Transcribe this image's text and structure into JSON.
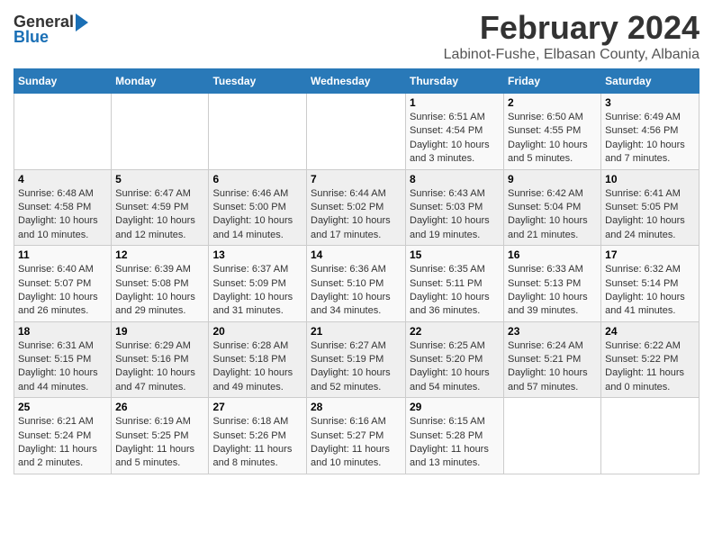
{
  "header": {
    "logo_general": "General",
    "logo_blue": "Blue",
    "month_title": "February 2024",
    "location": "Labinot-Fushe, Elbasan County, Albania"
  },
  "days_of_week": [
    "Sunday",
    "Monday",
    "Tuesday",
    "Wednesday",
    "Thursday",
    "Friday",
    "Saturday"
  ],
  "weeks": [
    [
      {
        "day": "",
        "info": ""
      },
      {
        "day": "",
        "info": ""
      },
      {
        "day": "",
        "info": ""
      },
      {
        "day": "",
        "info": ""
      },
      {
        "day": "1",
        "info": "Sunrise: 6:51 AM\nSunset: 4:54 PM\nDaylight: 10 hours and 3 minutes."
      },
      {
        "day": "2",
        "info": "Sunrise: 6:50 AM\nSunset: 4:55 PM\nDaylight: 10 hours and 5 minutes."
      },
      {
        "day": "3",
        "info": "Sunrise: 6:49 AM\nSunset: 4:56 PM\nDaylight: 10 hours and 7 minutes."
      }
    ],
    [
      {
        "day": "4",
        "info": "Sunrise: 6:48 AM\nSunset: 4:58 PM\nDaylight: 10 hours and 10 minutes."
      },
      {
        "day": "5",
        "info": "Sunrise: 6:47 AM\nSunset: 4:59 PM\nDaylight: 10 hours and 12 minutes."
      },
      {
        "day": "6",
        "info": "Sunrise: 6:46 AM\nSunset: 5:00 PM\nDaylight: 10 hours and 14 minutes."
      },
      {
        "day": "7",
        "info": "Sunrise: 6:44 AM\nSunset: 5:02 PM\nDaylight: 10 hours and 17 minutes."
      },
      {
        "day": "8",
        "info": "Sunrise: 6:43 AM\nSunset: 5:03 PM\nDaylight: 10 hours and 19 minutes."
      },
      {
        "day": "9",
        "info": "Sunrise: 6:42 AM\nSunset: 5:04 PM\nDaylight: 10 hours and 21 minutes."
      },
      {
        "day": "10",
        "info": "Sunrise: 6:41 AM\nSunset: 5:05 PM\nDaylight: 10 hours and 24 minutes."
      }
    ],
    [
      {
        "day": "11",
        "info": "Sunrise: 6:40 AM\nSunset: 5:07 PM\nDaylight: 10 hours and 26 minutes."
      },
      {
        "day": "12",
        "info": "Sunrise: 6:39 AM\nSunset: 5:08 PM\nDaylight: 10 hours and 29 minutes."
      },
      {
        "day": "13",
        "info": "Sunrise: 6:37 AM\nSunset: 5:09 PM\nDaylight: 10 hours and 31 minutes."
      },
      {
        "day": "14",
        "info": "Sunrise: 6:36 AM\nSunset: 5:10 PM\nDaylight: 10 hours and 34 minutes."
      },
      {
        "day": "15",
        "info": "Sunrise: 6:35 AM\nSunset: 5:11 PM\nDaylight: 10 hours and 36 minutes."
      },
      {
        "day": "16",
        "info": "Sunrise: 6:33 AM\nSunset: 5:13 PM\nDaylight: 10 hours and 39 minutes."
      },
      {
        "day": "17",
        "info": "Sunrise: 6:32 AM\nSunset: 5:14 PM\nDaylight: 10 hours and 41 minutes."
      }
    ],
    [
      {
        "day": "18",
        "info": "Sunrise: 6:31 AM\nSunset: 5:15 PM\nDaylight: 10 hours and 44 minutes."
      },
      {
        "day": "19",
        "info": "Sunrise: 6:29 AM\nSunset: 5:16 PM\nDaylight: 10 hours and 47 minutes."
      },
      {
        "day": "20",
        "info": "Sunrise: 6:28 AM\nSunset: 5:18 PM\nDaylight: 10 hours and 49 minutes."
      },
      {
        "day": "21",
        "info": "Sunrise: 6:27 AM\nSunset: 5:19 PM\nDaylight: 10 hours and 52 minutes."
      },
      {
        "day": "22",
        "info": "Sunrise: 6:25 AM\nSunset: 5:20 PM\nDaylight: 10 hours and 54 minutes."
      },
      {
        "day": "23",
        "info": "Sunrise: 6:24 AM\nSunset: 5:21 PM\nDaylight: 10 hours and 57 minutes."
      },
      {
        "day": "24",
        "info": "Sunrise: 6:22 AM\nSunset: 5:22 PM\nDaylight: 11 hours and 0 minutes."
      }
    ],
    [
      {
        "day": "25",
        "info": "Sunrise: 6:21 AM\nSunset: 5:24 PM\nDaylight: 11 hours and 2 minutes."
      },
      {
        "day": "26",
        "info": "Sunrise: 6:19 AM\nSunset: 5:25 PM\nDaylight: 11 hours and 5 minutes."
      },
      {
        "day": "27",
        "info": "Sunrise: 6:18 AM\nSunset: 5:26 PM\nDaylight: 11 hours and 8 minutes."
      },
      {
        "day": "28",
        "info": "Sunrise: 6:16 AM\nSunset: 5:27 PM\nDaylight: 11 hours and 10 minutes."
      },
      {
        "day": "29",
        "info": "Sunrise: 6:15 AM\nSunset: 5:28 PM\nDaylight: 11 hours and 13 minutes."
      },
      {
        "day": "",
        "info": ""
      },
      {
        "day": "",
        "info": ""
      }
    ]
  ]
}
